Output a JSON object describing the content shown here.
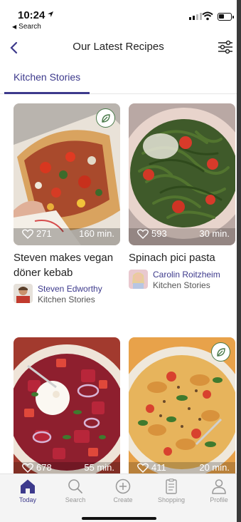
{
  "status_bar": {
    "time": "10:24",
    "back_app": "Search"
  },
  "header": {
    "title": "Our Latest Recipes"
  },
  "tabs": [
    {
      "label": "Kitchen Stories",
      "active": true
    }
  ],
  "recipes": [
    {
      "title": "Steven makes vegan döner kebab",
      "likes": "271",
      "duration": "160 min.",
      "vegetarian": true,
      "author": {
        "name": "Steven Edworthy",
        "org": "Kitchen Stories"
      }
    },
    {
      "title": "Spinach pici pasta",
      "likes": "593",
      "duration": "30 min.",
      "vegetarian": false,
      "author": {
        "name": "Carolin Roitzheim",
        "org": "Kitchen Stories"
      }
    },
    {
      "title": "",
      "likes": "678",
      "duration": "55 min.",
      "vegetarian": false
    },
    {
      "title": "",
      "likes": "411",
      "duration": "20 min.",
      "vegetarian": true
    }
  ],
  "tabbar": [
    {
      "label": "Today",
      "icon": "home-icon",
      "active": true
    },
    {
      "label": "Search",
      "icon": "search-icon",
      "active": false
    },
    {
      "label": "Create",
      "icon": "plus-circle-icon",
      "active": false
    },
    {
      "label": "Shopping",
      "icon": "shopping-list-icon",
      "active": false
    },
    {
      "label": "Profile",
      "icon": "profile-icon",
      "active": false
    }
  ],
  "colors": {
    "accent": "#3d3a8c",
    "veg_badge": "#4a7a4a",
    "tab_inactive": "#999999"
  }
}
